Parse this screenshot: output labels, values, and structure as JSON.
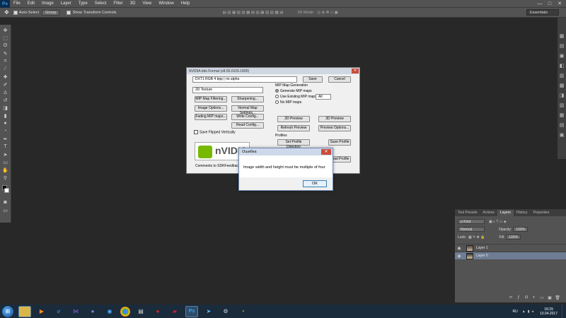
{
  "menubar": {
    "logo": "Ps",
    "items": [
      "File",
      "Edit",
      "Image",
      "Layer",
      "Type",
      "Select",
      "Filter",
      "3D",
      "View",
      "Window",
      "Help"
    ],
    "min": "—",
    "max": "□",
    "close": "✕"
  },
  "options": {
    "auto_select": "Auto-Select",
    "group": "Group",
    "show_transform": "Show Transform Controls",
    "mode_3d": "3D Mode:",
    "workspace": "Essentials"
  },
  "nvidia": {
    "title": "NVIDIA dds Format (v8.55.0109.1800)",
    "format": "DXT1        RGB   4 bpp | no alpha",
    "save": "Save",
    "cancel": "Cancel",
    "texture_type": "2D Texture",
    "mip_filtering": "MIP Map Filtering...",
    "sharpening": "Sharpening...",
    "image_options": "Image Options...",
    "normal_map": "Normal Map Settings...",
    "fading": "Fading MIP maps...",
    "write_config": "Write Config...",
    "read_config": "Read Config...",
    "save_flipped": "Save Flipped Vertically",
    "mip_generation": "MIP Map Generation",
    "generate": "Generate MIP maps",
    "use_existing": "Use Existing MIP maps",
    "all": "All",
    "no_mip": "No MIP maps",
    "preview_2d": "2D Preview",
    "preview_3d": "3D Preview",
    "refresh": "Refresh Preview",
    "preview_options": "Preview Options...",
    "profiles": "Profiles",
    "set_profile_dir": "Set Profile Directory",
    "save_profile": "Save Profile",
    "load_profile": "Load Profile",
    "comments": "Comments to SDKFeedback@",
    "logo": "nVIDIA"
  },
  "error": {
    "title": "Ошибка",
    "close": "✕",
    "message": "Image width and height must be multiple of four",
    "ok": "OK"
  },
  "layers": {
    "tabs": [
      "Tool Presets",
      "Actions",
      "Layers",
      "History",
      "Properties"
    ],
    "kind": "ρ Kind",
    "blend": "Normal",
    "opacity_label": "Opacity:",
    "opacity": "100%",
    "lock_label": "Lock:",
    "fill_label": "Fill:",
    "fill": "100%",
    "items": [
      {
        "name": "Layer 1"
      },
      {
        "name": "Layer 0"
      }
    ]
  },
  "taskbar": {
    "lang": "RU",
    "time": "18:29",
    "date": "13.04.2017"
  }
}
